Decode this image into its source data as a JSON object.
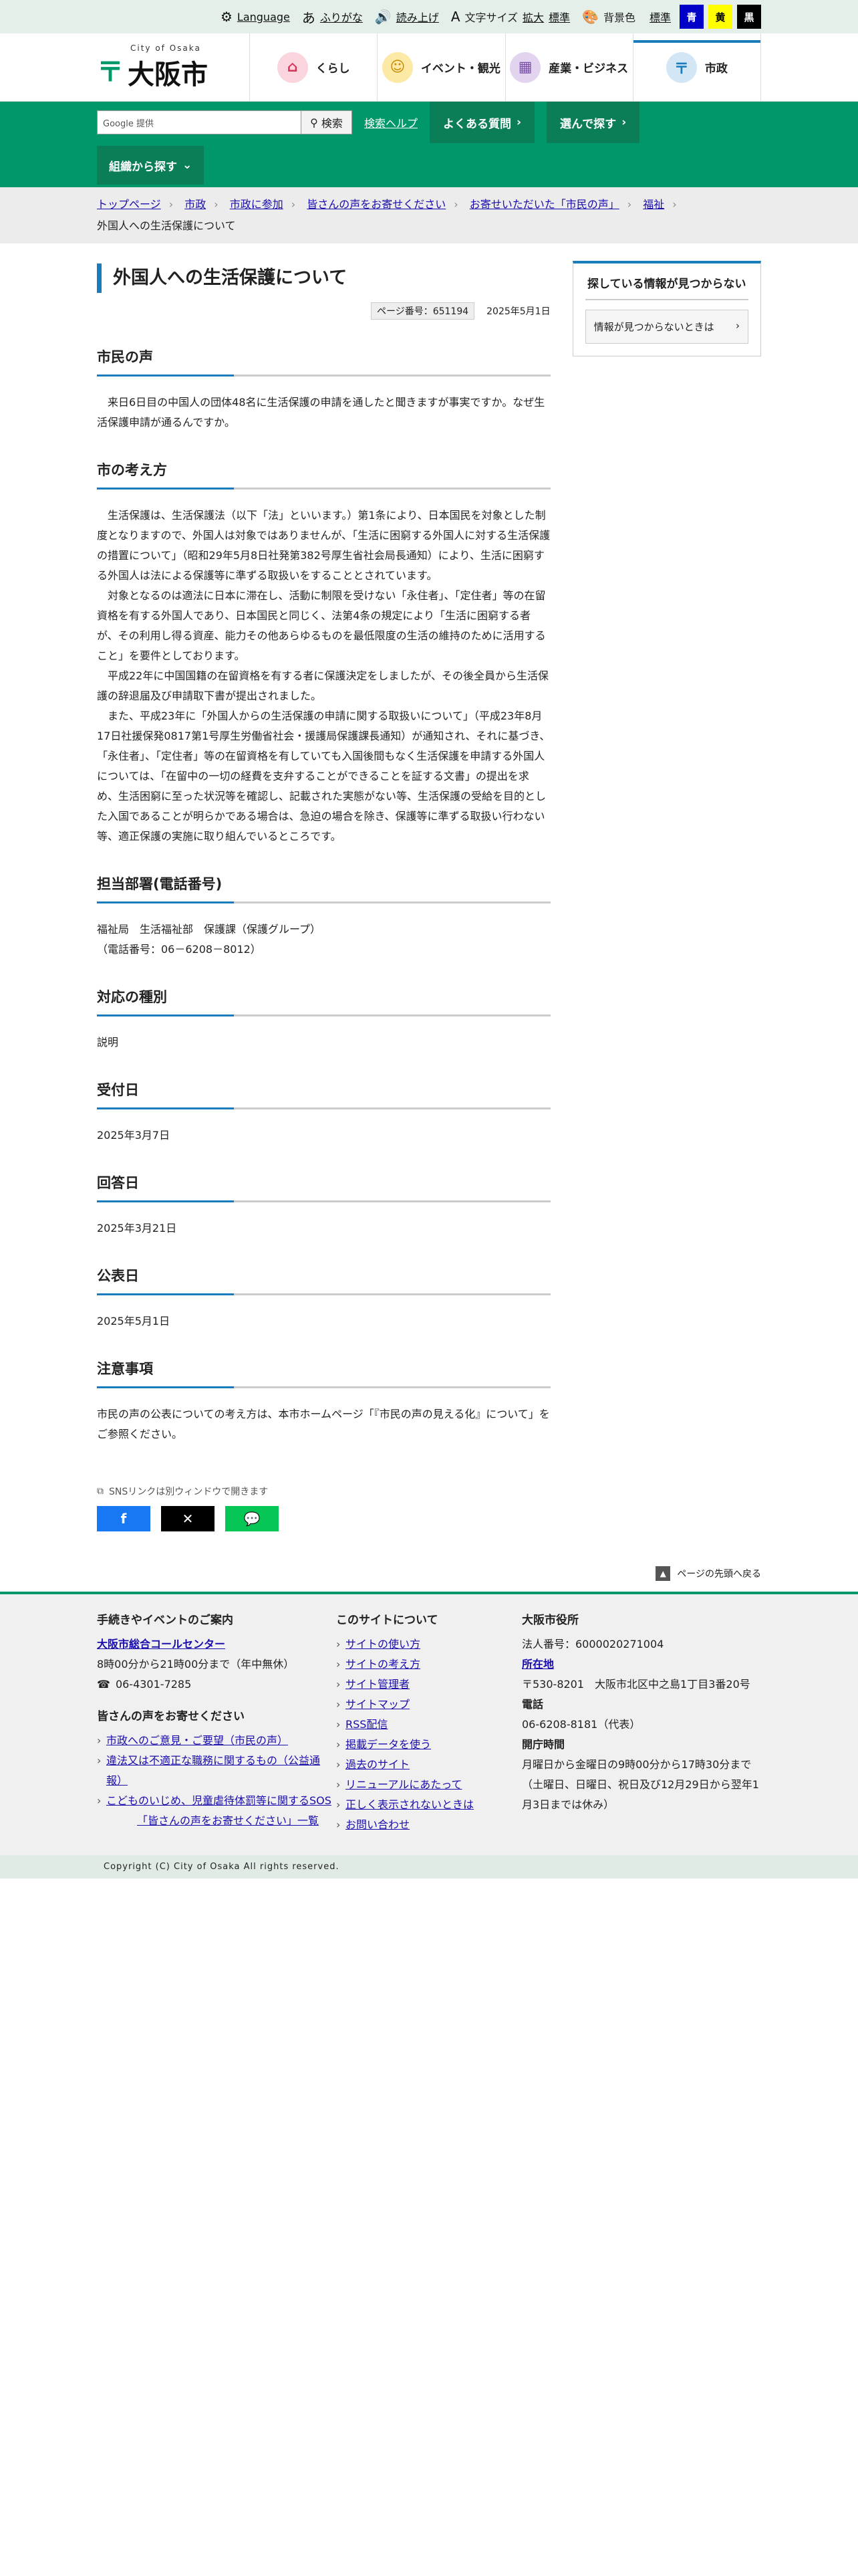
{
  "util": {
    "language": "Language",
    "furigana": "ふりがな",
    "readaloud": "読み上げ",
    "fontsize_label": "文字サイズ",
    "fontsize_large": "拡大",
    "fontsize_std": "標準",
    "bgcolor_label": "背景色",
    "bg_std": "標準",
    "bg_blue": "青",
    "bg_yellow": "黄",
    "bg_black": "黒"
  },
  "header": {
    "logo_sub": "City of Osaka",
    "logo_text": "大阪市",
    "nav": [
      "くらし",
      "イベント・観光",
      "産業・ビジネス",
      "市政"
    ]
  },
  "greenbar": {
    "search_placeholder": "Google 提供",
    "search_button": "検索",
    "search_help": "検索ヘルプ",
    "faq": "よくある質問",
    "choose": "選んで探す",
    "org": "組織から探す"
  },
  "breadcrumb": {
    "items": [
      "トップページ",
      "市政",
      "市政に参加",
      "皆さんの声をお寄せください",
      "お寄せいただいた「市民の声」",
      "福祉"
    ],
    "current": "外国人への生活保護について"
  },
  "page": {
    "title": "外国人への生活保護について",
    "page_no": "ページ番号：651194",
    "date": "2025年5月1日"
  },
  "sections": {
    "voice_h": "市民の声",
    "voice_body": "来日6日目の中国人の団体48名に生活保護の申請を通したと聞きますが事実ですか。なぜ生活保護申請が通るんですか。",
    "view_h": "市の考え方",
    "view_p1": "生活保護は、生活保護法（以下「法」といいます。）第1条により、日本国民を対象とした制度となりますので、外国人は対象ではありませんが、「生活に困窮する外国人に対する生活保護の措置について」（昭和29年5月8日社発第382号厚生省社会局長通知）により、生活に困窮する外国人は法による保護等に準ずる取扱いをすることとされています。",
    "view_p2": "対象となるのは適法に日本に滞在し、活動に制限を受けない「永住者」、「定住者」等の在留資格を有する外国人であり、日本国民と同じく、法第4条の規定により「生活に困窮する者が、その利用し得る資産、能力その他あらゆるものを最低限度の生活の維持のために活用すること」を要件としております。",
    "view_p3": "平成22年に中国国籍の在留資格を有する者に保護決定をしましたが、その後全員から生活保護の辞退届及び申請取下書が提出されました。",
    "view_p4": "また、平成23年に「外国人からの生活保護の申請に関する取扱いについて」（平成23年8月17日社援保発0817第1号厚生労働省社会・援護局保護課長通知）が通知され、それに基づき、「永住者」、「定住者」等の在留資格を有していても入国後間もなく生活保護を申請する外国人については、「在留中の一切の経費を支弁することができることを証する文書」の提出を求め、生活困窮に至った状況等を確認し、記載された実態がない等、生活保護の受給を目的とした入国であることが明らかである場合は、急迫の場合を除き、保護等に準ずる取扱い行わない等、適正保護の実施に取り組んでいるところです。",
    "dept_h": "担当部署(電話番号)",
    "dept_line1": "福祉局　生活福祉部　保護課（保護グループ）",
    "dept_line2": "（電話番号：06－6208－8012）",
    "type_h": "対応の種別",
    "type_body": "説明",
    "recv_h": "受付日",
    "recv_body": "2025年3月7日",
    "ans_h": "回答日",
    "ans_body": "2025年3月21日",
    "pub_h": "公表日",
    "pub_body": "2025年5月1日",
    "note_h": "注意事項",
    "note_body": "市民の声の公表についての考え方は、本市ホームページ「『市民の声の見える化』について」をご参照ください。",
    "sns_note": "SNSリンクは別ウィンドウで開きます"
  },
  "sidebar": {
    "title": "探している情報が見つからない",
    "link": "情報が見つからないときは"
  },
  "pagetop": "ページの先頭へ戻る",
  "footer": {
    "c1_h": "手続きやイベントのご案内",
    "c1_center": "大阪市総合コールセンター",
    "c1_hours": "8時00分から21時00分まで（年中無休）",
    "c1_tel": "06-4301-7285",
    "c1_h2": "皆さんの声をお寄せください",
    "c1_links": [
      "市政へのご意見・ご要望（市民の声）",
      "違法又は不適正な職務に関するもの（公益通報）",
      "こどものいじめ、児童虐待体罰等に関するSOS"
    ],
    "c1_all": "「皆さんの声をお寄せください」一覧",
    "c2_h": "このサイトについて",
    "c2_links": [
      "サイトの使い方",
      "サイトの考え方",
      "サイト管理者",
      "サイトマップ",
      "RSS配信",
      "掲載データを使う",
      "過去のサイト",
      "リニューアルにあたって",
      "正しく表示されないときは",
      "お問い合わせ"
    ],
    "c3_h": "大阪市役所",
    "c3_corp": "法人番号：6000020271004",
    "c3_loc_h": "所在地",
    "c3_loc": "〒530-8201　大阪市北区中之島1丁目3番20号",
    "c3_tel_h": "電話",
    "c3_tel": "06-6208-8181（代表）",
    "c3_open_h": "開庁時間",
    "c3_open": "月曜日から金曜日の9時00分から17時30分まで",
    "c3_open2": "（土曜日、日曜日、祝日及び12月29日から翌年1月3日までは休み）"
  },
  "copyright": "Copyright (C) City of Osaka All rights reserved."
}
